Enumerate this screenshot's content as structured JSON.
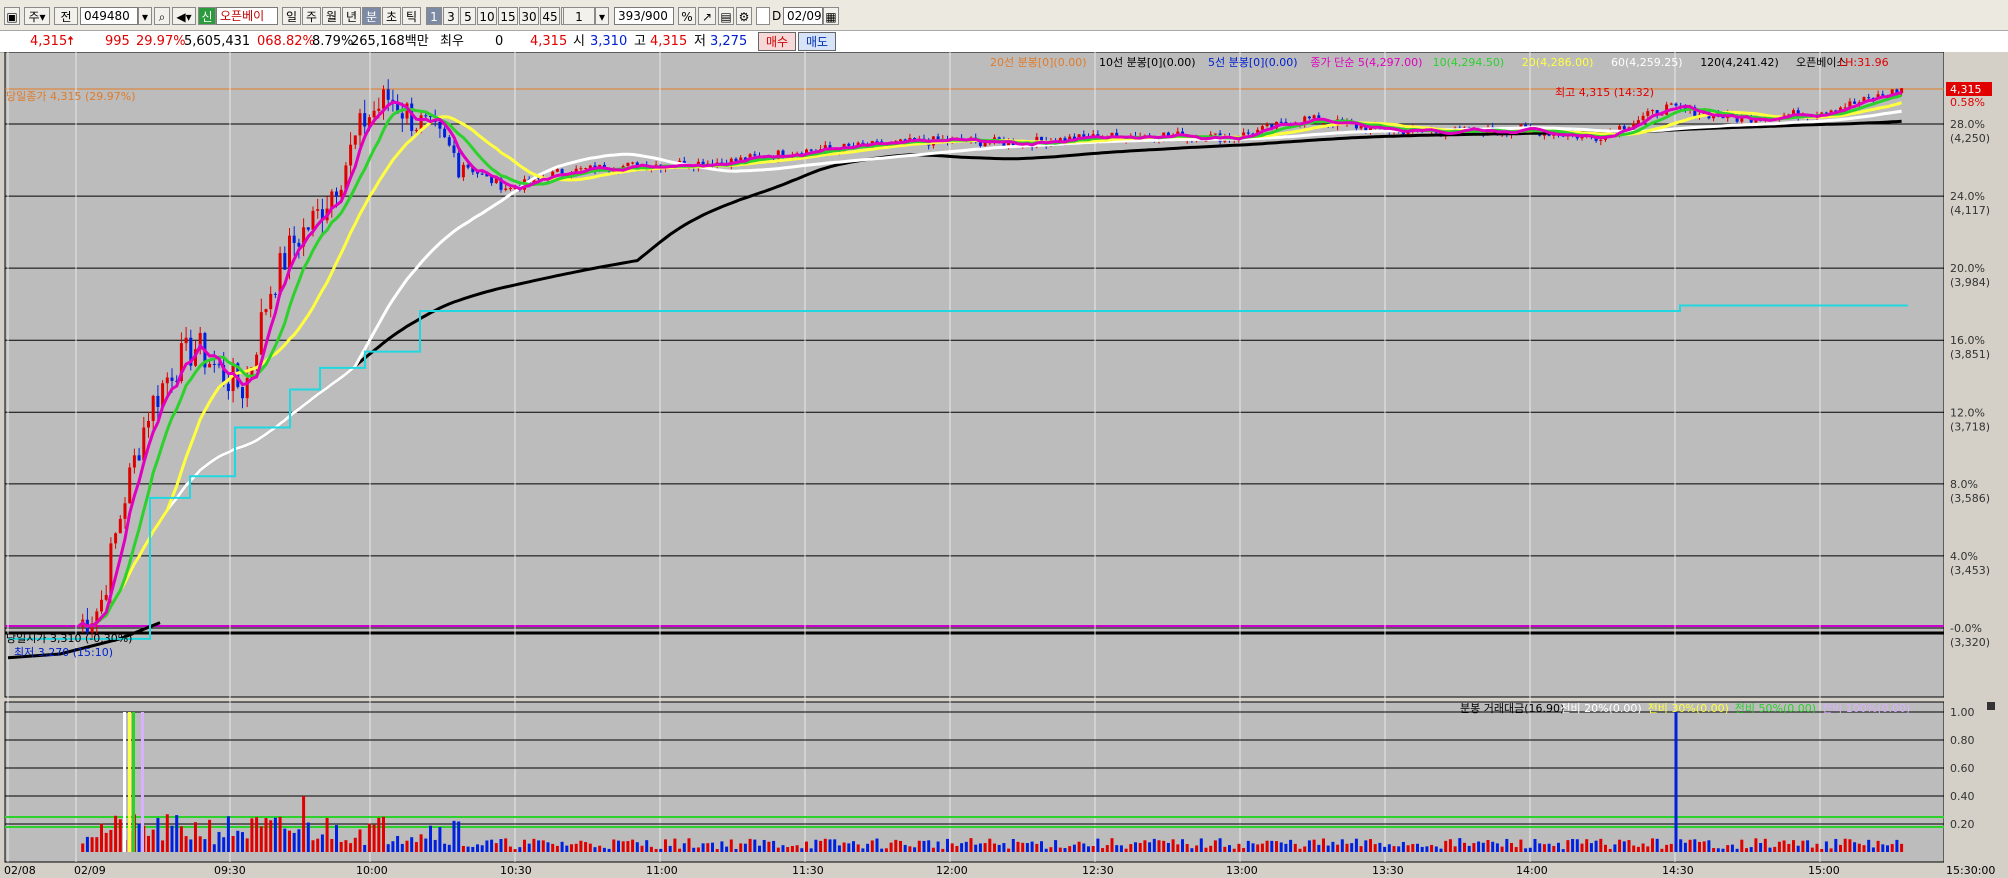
{
  "toolbar": {
    "market": "주",
    "mode": "전",
    "code": "049480",
    "new_badge": "신",
    "name": "오픈베이",
    "periods": [
      "일",
      "주",
      "월",
      "년",
      "분",
      "초",
      "틱"
    ],
    "intervals": [
      "1",
      "3",
      "5",
      "10",
      "15",
      "30",
      "45",
      "60"
    ],
    "active_period": "분",
    "active_interval": "1",
    "interval_input": "1",
    "count": "393/900",
    "date_checkbox_label": "D",
    "date": "02/09"
  },
  "quote": {
    "price": "4,315",
    "change": "995",
    "change_rate": "29.97%",
    "volume": "5,605,431",
    "volume_ratio": "068.82%",
    "turnover": "8.79%",
    "amount": "265,168백만",
    "best_label": "최우",
    "best_value": "0",
    "price2": "4,315",
    "open_label": "시",
    "open": "3,310",
    "high_label": "고",
    "high": "4,315",
    "low_label": "저",
    "low": "3,275",
    "buy_label": "매수",
    "sell_label": "매도"
  },
  "legend_top": [
    {
      "text": "20선 분봉[0](0.00)",
      "color": "#e27b28"
    },
    {
      "text": "10선 분봉[0](0.00)",
      "color": "#000000"
    },
    {
      "text": "5선 분봉[0](0.00)",
      "color": "#0020d0"
    },
    {
      "text": "종가 단순 5(4,297.00)",
      "color": "#e000c0"
    },
    {
      "text": "10(4,294.50)",
      "color": "#2cd12c"
    },
    {
      "text": "20(4,286.00)",
      "color": "#ffff40"
    },
    {
      "text": "60(4,259.25)",
      "color": "#ffffff"
    },
    {
      "text": "120(4,241.42)",
      "color": "#000000"
    },
    {
      "text": "오픈베이스",
      "color": "#000000"
    },
    {
      "text": "LH:31.96",
      "color": "#e00000"
    }
  ],
  "colors": {
    "panel_bg": "#bcbcbc",
    "up": "#e00000",
    "down": "#0020e0",
    "ma5": "#e000c0",
    "ma10": "#2cd12c",
    "ma20": "#ffff40",
    "ma60": "#ffffff",
    "ma120": "#000000",
    "cyan": "#22d8e0",
    "magenta_base": "#cc00cc",
    "high_line": "#e27b28"
  },
  "price_axis": [
    {
      "pct": "28.0%",
      "price": "(4,250)"
    },
    {
      "pct": "24.0%",
      "price": "(4,117)"
    },
    {
      "pct": "20.0%",
      "price": "(3,984)"
    },
    {
      "pct": "16.0%",
      "price": "(3,851)"
    },
    {
      "pct": "12.0%",
      "price": "(3,718)"
    },
    {
      "pct": "8.0%",
      "price": "(3,586)"
    },
    {
      "pct": "4.0%",
      "price": "(3,453)"
    },
    {
      "pct": "-0.0%",
      "price": "(3,320)"
    }
  ],
  "current_price_tag": "4,315",
  "current_pct_tag": "0.58%",
  "annotations": {
    "limit_up": "당일종가 4,315 (29.97%)",
    "high": "최고 4,315 (14:32)",
    "prev_close": "당일시가 3,310 (-0.30%)",
    "low": "최저 3,270 (15:10)"
  },
  "volume_legend": [
    {
      "text": "분봉 거래대금(16.90)",
      "color": "#000000"
    },
    {
      "text": "전비 20%(0.00)",
      "color": "#ffffff"
    },
    {
      "text": "전비 30%(0.00)",
      "color": "#ffff40"
    },
    {
      "text": "전비 50%(0.00)",
      "color": "#2cd12c"
    },
    {
      "text": "전비 100%(0.00)",
      "color": "#d8b0ff"
    }
  ],
  "volume_axis": [
    "1.00",
    "0.80",
    "0.60",
    "0.40",
    "0.20"
  ],
  "time_axis": [
    "02/08",
    "02/09",
    "09:30",
    "10:00",
    "10:30",
    "11:00",
    "11:30",
    "12:00",
    "12:30",
    "13:00",
    "13:30",
    "14:00",
    "14:30",
    "15:00",
    "15:30:00"
  ],
  "chart_data": {
    "type": "candlestick",
    "note_series": [
      "close"
    ],
    "x": [
      "09:00",
      "09:05",
      "09:10",
      "09:15",
      "09:20",
      "09:25",
      "09:30",
      "09:35",
      "09:40",
      "09:45",
      "09:50",
      "09:55",
      "10:00",
      "10:05",
      "10:10",
      "10:15",
      "10:20",
      "10:25",
      "10:30",
      "10:40",
      "10:50",
      "11:00",
      "11:15",
      "11:30",
      "11:45",
      "12:00",
      "12:15",
      "12:30",
      "12:45",
      "13:00",
      "13:15",
      "13:30",
      "13:45",
      "14:00",
      "14:15",
      "14:30",
      "14:45",
      "15:00",
      "15:10",
      "15:19"
    ],
    "close": [
      3320,
      3360,
      3560,
      3720,
      3800,
      3840,
      3790,
      3760,
      3940,
      4030,
      4080,
      4160,
      4260,
      4300,
      4260,
      4220,
      4180,
      4150,
      4130,
      4160,
      4170,
      4175,
      4180,
      4200,
      4210,
      4220,
      4215,
      4225,
      4230,
      4225,
      4260,
      4240,
      4235,
      4240,
      4225,
      4280,
      4260,
      4270,
      4290,
      4315
    ],
    "ylim": [
      3300,
      4350
    ],
    "volume_max": 1.0
  }
}
